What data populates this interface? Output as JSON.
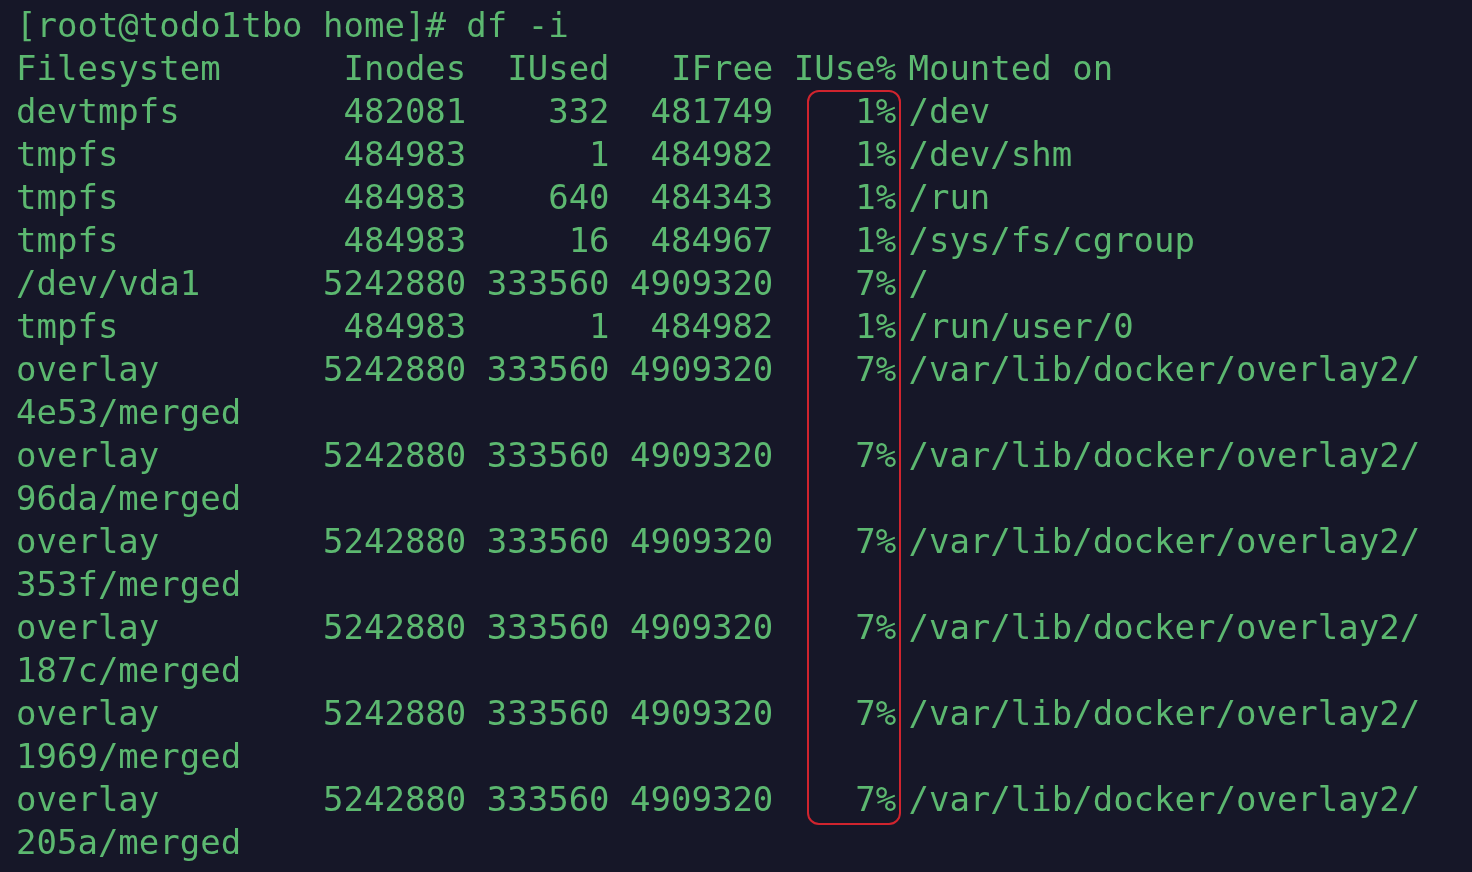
{
  "prompt": "[root@todo1tbo home]# df -i",
  "columns": [
    {
      "label": "Filesystem",
      "highlighted": false
    },
    {
      "label": "Inodes",
      "highlighted": false
    },
    {
      "label": "IUsed",
      "highlighted": false
    },
    {
      "label": "IFree",
      "highlighted": false
    },
    {
      "label": "IUse%",
      "highlighted": true
    },
    {
      "label": "Mounted on",
      "highlighted": false
    }
  ],
  "rows": [
    {
      "filesystem": "devtmpfs",
      "inodes": "482081",
      "iused": "332",
      "ifree": "481749",
      "iuse_percent": "1%",
      "mounted_on": "/dev"
    },
    {
      "filesystem": "tmpfs",
      "inodes": "484983",
      "iused": "1",
      "ifree": "484982",
      "iuse_percent": "1%",
      "mounted_on": "/dev/shm"
    },
    {
      "filesystem": "tmpfs",
      "inodes": "484983",
      "iused": "640",
      "ifree": "484343",
      "iuse_percent": "1%",
      "mounted_on": "/run"
    },
    {
      "filesystem": "tmpfs",
      "inodes": "484983",
      "iused": "16",
      "ifree": "484967",
      "iuse_percent": "1%",
      "mounted_on": "/sys/fs/cgroup"
    },
    {
      "filesystem": "/dev/vda1",
      "inodes": "5242880",
      "iused": "333560",
      "ifree": "4909320",
      "iuse_percent": "7%",
      "mounted_on": "/"
    },
    {
      "filesystem": "tmpfs",
      "inodes": "484983",
      "iused": "1",
      "ifree": "484982",
      "iuse_percent": "1%",
      "mounted_on": "/run/user/0"
    },
    {
      "filesystem": "overlay",
      "inodes": "5242880",
      "iused": "333560",
      "ifree": "4909320",
      "iuse_percent": "7%",
      "mounted_on": "/var/lib/docker/overlay2/",
      "wrapped": "4e53/merged"
    },
    {
      "filesystem": "overlay",
      "inodes": "5242880",
      "iused": "333560",
      "ifree": "4909320",
      "iuse_percent": "7%",
      "mounted_on": "/var/lib/docker/overlay2/",
      "wrapped": "96da/merged"
    },
    {
      "filesystem": "overlay",
      "inodes": "5242880",
      "iused": "333560",
      "ifree": "4909320",
      "iuse_percent": "7%",
      "mounted_on": "/var/lib/docker/overlay2/",
      "wrapped": "353f/merged"
    },
    {
      "filesystem": "overlay",
      "inodes": "5242880",
      "iused": "333560",
      "ifree": "4909320",
      "iuse_percent": "7%",
      "mounted_on": "/var/lib/docker/overlay2/",
      "wrapped": "187c/merged"
    },
    {
      "filesystem": "overlay",
      "inodes": "5242880",
      "iused": "333560",
      "ifree": "4909320",
      "iuse_percent": "7%",
      "mounted_on": "/var/lib/docker/overlay2/",
      "wrapped": "1969/merged"
    },
    {
      "filesystem": "overlay",
      "inodes": "5242880",
      "iused": "333560",
      "ifree": "4909320",
      "iuse_percent": "7%",
      "mounted_on": "/var/lib/docker/overlay2/",
      "wrapped": "205a/merged"
    }
  ]
}
